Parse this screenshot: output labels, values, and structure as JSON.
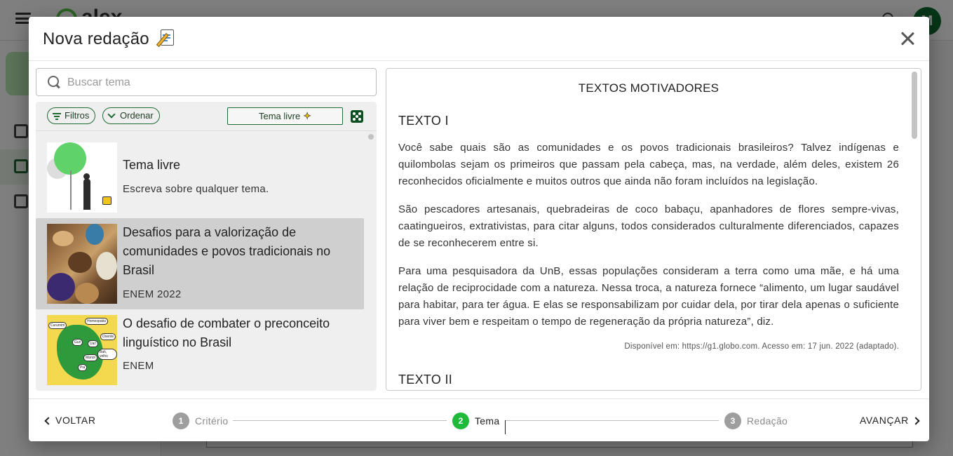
{
  "background_app": {
    "logo_text": "alex",
    "avatar_initial": "M"
  },
  "dialog": {
    "title": "Nova redação",
    "title_emoji_icon": "memo-icon",
    "close_icon": "close-icon"
  },
  "search": {
    "placeholder": "Buscar tema",
    "value": ""
  },
  "toolbar": {
    "filters_label": "Filtros",
    "sort_label": "Ordenar",
    "free_theme_label": "Tema livre",
    "free_theme_icon": "sparkle-icon",
    "random_icon": "dice-icon"
  },
  "themes": [
    {
      "title": "Tema livre",
      "subtitle": "Escreva sobre qualquer tema.",
      "selected": false
    },
    {
      "title": "Desafios para a valorização de comunidades e povos tradicionais no Brasil",
      "subtitle": "ENEM 2022",
      "selected": true
    },
    {
      "title": "O desafio de combater o preconceito linguístico no Brasil",
      "subtitle": "ENEM",
      "selected": false
    }
  ],
  "map_bubbles": [
    "Curumim",
    "Guri",
    "Homeopatia",
    "Uai!",
    "Oxente",
    "Manor",
    "Bah, velho",
    "Piá"
  ],
  "motivating": {
    "heading": "TEXTOS MOTIVADORES",
    "texto1_title": "TEXTO I",
    "p1": "Você sabe quais são as comunidades e os povos tradicionais brasileiros? Talvez indígenas e quilombolas sejam os primeiros que passam pela cabeça, mas, na verdade, além deles, existem 26 reconhecidos oficialmente e muitos outros que ainda não foram incluídos na legislação.",
    "p2": "São pescadores artesanais, quebradeiras de coco babaçu, apanhadores de flores sempre-vivas, caatingueiros, extrativistas, para citar alguns, todos considerados culturalmente diferenciados, capazes de se reconhecerem entre si.",
    "p3": "Para uma pesquisadora da UnB, essas populações consideram a terra como uma mãe, e há uma relação de reciprocidade com a natureza. Nessa troca, a natureza fornece “alimento, um lugar saudável para habitar, para ter água. E elas se responsabilizam por cuidar dela, por tirar dela apenas o suficiente para viver bem e respeitam o tempo de regeneração da própria natureza”, diz.",
    "source": "Disponível em: https://g1.globo.com. Acesso em: 17 jun. 2022 (adaptado).",
    "texto2_title": "TEXTO II"
  },
  "footer": {
    "back_label": "VOLTAR",
    "next_label": "AVANÇAR",
    "steps": [
      {
        "number": "1",
        "label": "Critério",
        "active": false
      },
      {
        "number": "2",
        "label": "Tema",
        "active": true
      },
      {
        "number": "3",
        "label": "Redação",
        "active": false
      }
    ]
  },
  "colors": {
    "primary_green": "#1f6b34",
    "active_step": "#1fba3a",
    "selected_item": "#cfcfcf"
  }
}
